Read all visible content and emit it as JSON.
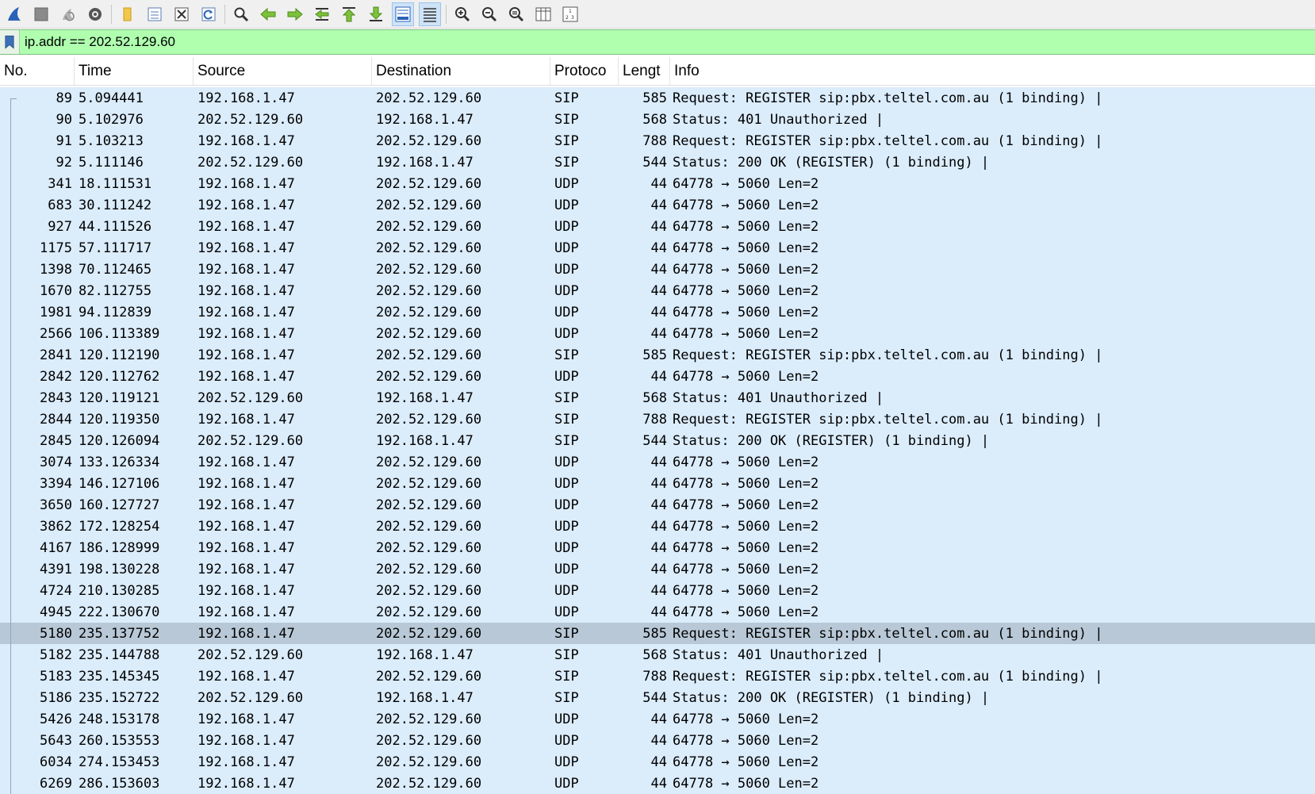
{
  "toolbar": {
    "buttons": [
      {
        "name": "shark-fin-start-icon"
      },
      {
        "name": "stop-capture-icon"
      },
      {
        "name": "restart-capture-icon"
      },
      {
        "name": "capture-options-icon"
      },
      {
        "name": "open-file-icon"
      },
      {
        "name": "save-file-icon"
      },
      {
        "name": "close-file-icon"
      },
      {
        "name": "reload-file-icon"
      },
      {
        "name": "find-packet-icon"
      },
      {
        "name": "go-back-icon"
      },
      {
        "name": "go-forward-icon"
      },
      {
        "name": "go-to-packet-icon"
      },
      {
        "name": "first-packet-icon"
      },
      {
        "name": "last-packet-icon"
      },
      {
        "name": "auto-scroll-icon"
      },
      {
        "name": "colorize-icon"
      },
      {
        "name": "zoom-in-icon"
      },
      {
        "name": "zoom-out-icon"
      },
      {
        "name": "normal-size-icon"
      },
      {
        "name": "resize-columns-icon"
      },
      {
        "name": "numbered-list-icon"
      }
    ]
  },
  "filter": {
    "value": "ip.addr == 202.52.129.60"
  },
  "columns": {
    "no": "No.",
    "time": "Time",
    "source": "Source",
    "destination": "Destination",
    "protocol": "Protoco",
    "length": "Lengt",
    "info": "Info"
  },
  "packets": [
    {
      "no": "89",
      "time": "5.094441",
      "src": "192.168.1.47",
      "dst": "202.52.129.60",
      "proto": "SIP",
      "len": "585",
      "info": "Request: REGISTER sip:pbx.teltel.com.au  (1 binding) |"
    },
    {
      "no": "90",
      "time": "5.102976",
      "src": "202.52.129.60",
      "dst": "192.168.1.47",
      "proto": "SIP",
      "len": "568",
      "info": "Status: 401 Unauthorized |"
    },
    {
      "no": "91",
      "time": "5.103213",
      "src": "192.168.1.47",
      "dst": "202.52.129.60",
      "proto": "SIP",
      "len": "788",
      "info": "Request: REGISTER sip:pbx.teltel.com.au  (1 binding) |"
    },
    {
      "no": "92",
      "time": "5.111146",
      "src": "202.52.129.60",
      "dst": "192.168.1.47",
      "proto": "SIP",
      "len": "544",
      "info": "Status: 200 OK (REGISTER)  (1 binding) |"
    },
    {
      "no": "341",
      "time": "18.111531",
      "src": "192.168.1.47",
      "dst": "202.52.129.60",
      "proto": "UDP",
      "len": "44",
      "info": "64778 → 5060 Len=2"
    },
    {
      "no": "683",
      "time": "30.111242",
      "src": "192.168.1.47",
      "dst": "202.52.129.60",
      "proto": "UDP",
      "len": "44",
      "info": "64778 → 5060 Len=2"
    },
    {
      "no": "927",
      "time": "44.111526",
      "src": "192.168.1.47",
      "dst": "202.52.129.60",
      "proto": "UDP",
      "len": "44",
      "info": "64778 → 5060 Len=2"
    },
    {
      "no": "1175",
      "time": "57.111717",
      "src": "192.168.1.47",
      "dst": "202.52.129.60",
      "proto": "UDP",
      "len": "44",
      "info": "64778 → 5060 Len=2"
    },
    {
      "no": "1398",
      "time": "70.112465",
      "src": "192.168.1.47",
      "dst": "202.52.129.60",
      "proto": "UDP",
      "len": "44",
      "info": "64778 → 5060 Len=2"
    },
    {
      "no": "1670",
      "time": "82.112755",
      "src": "192.168.1.47",
      "dst": "202.52.129.60",
      "proto": "UDP",
      "len": "44",
      "info": "64778 → 5060 Len=2"
    },
    {
      "no": "1981",
      "time": "94.112839",
      "src": "192.168.1.47",
      "dst": "202.52.129.60",
      "proto": "UDP",
      "len": "44",
      "info": "64778 → 5060 Len=2"
    },
    {
      "no": "2566",
      "time": "106.113389",
      "src": "192.168.1.47",
      "dst": "202.52.129.60",
      "proto": "UDP",
      "len": "44",
      "info": "64778 → 5060 Len=2"
    },
    {
      "no": "2841",
      "time": "120.112190",
      "src": "192.168.1.47",
      "dst": "202.52.129.60",
      "proto": "SIP",
      "len": "585",
      "info": "Request: REGISTER sip:pbx.teltel.com.au  (1 binding) |"
    },
    {
      "no": "2842",
      "time": "120.112762",
      "src": "192.168.1.47",
      "dst": "202.52.129.60",
      "proto": "UDP",
      "len": "44",
      "info": "64778 → 5060 Len=2"
    },
    {
      "no": "2843",
      "time": "120.119121",
      "src": "202.52.129.60",
      "dst": "192.168.1.47",
      "proto": "SIP",
      "len": "568",
      "info": "Status: 401 Unauthorized |"
    },
    {
      "no": "2844",
      "time": "120.119350",
      "src": "192.168.1.47",
      "dst": "202.52.129.60",
      "proto": "SIP",
      "len": "788",
      "info": "Request: REGISTER sip:pbx.teltel.com.au  (1 binding) |"
    },
    {
      "no": "2845",
      "time": "120.126094",
      "src": "202.52.129.60",
      "dst": "192.168.1.47",
      "proto": "SIP",
      "len": "544",
      "info": "Status: 200 OK (REGISTER)  (1 binding) |"
    },
    {
      "no": "3074",
      "time": "133.126334",
      "src": "192.168.1.47",
      "dst": "202.52.129.60",
      "proto": "UDP",
      "len": "44",
      "info": "64778 → 5060 Len=2"
    },
    {
      "no": "3394",
      "time": "146.127106",
      "src": "192.168.1.47",
      "dst": "202.52.129.60",
      "proto": "UDP",
      "len": "44",
      "info": "64778 → 5060 Len=2"
    },
    {
      "no": "3650",
      "time": "160.127727",
      "src": "192.168.1.47",
      "dst": "202.52.129.60",
      "proto": "UDP",
      "len": "44",
      "info": "64778 → 5060 Len=2"
    },
    {
      "no": "3862",
      "time": "172.128254",
      "src": "192.168.1.47",
      "dst": "202.52.129.60",
      "proto": "UDP",
      "len": "44",
      "info": "64778 → 5060 Len=2"
    },
    {
      "no": "4167",
      "time": "186.128999",
      "src": "192.168.1.47",
      "dst": "202.52.129.60",
      "proto": "UDP",
      "len": "44",
      "info": "64778 → 5060 Len=2"
    },
    {
      "no": "4391",
      "time": "198.130228",
      "src": "192.168.1.47",
      "dst": "202.52.129.60",
      "proto": "UDP",
      "len": "44",
      "info": "64778 → 5060 Len=2"
    },
    {
      "no": "4724",
      "time": "210.130285",
      "src": "192.168.1.47",
      "dst": "202.52.129.60",
      "proto": "UDP",
      "len": "44",
      "info": "64778 → 5060 Len=2"
    },
    {
      "no": "4945",
      "time": "222.130670",
      "src": "192.168.1.47",
      "dst": "202.52.129.60",
      "proto": "UDP",
      "len": "44",
      "info": "64778 → 5060 Len=2"
    },
    {
      "no": "5180",
      "time": "235.137752",
      "src": "192.168.1.47",
      "dst": "202.52.129.60",
      "proto": "SIP",
      "len": "585",
      "info": "Request: REGISTER sip:pbx.teltel.com.au  (1 binding) |",
      "selected": true
    },
    {
      "no": "5182",
      "time": "235.144788",
      "src": "202.52.129.60",
      "dst": "192.168.1.47",
      "proto": "SIP",
      "len": "568",
      "info": "Status: 401 Unauthorized |"
    },
    {
      "no": "5183",
      "time": "235.145345",
      "src": "192.168.1.47",
      "dst": "202.52.129.60",
      "proto": "SIP",
      "len": "788",
      "info": "Request: REGISTER sip:pbx.teltel.com.au  (1 binding) |"
    },
    {
      "no": "5186",
      "time": "235.152722",
      "src": "202.52.129.60",
      "dst": "192.168.1.47",
      "proto": "SIP",
      "len": "544",
      "info": "Status: 200 OK (REGISTER)  (1 binding) |"
    },
    {
      "no": "5426",
      "time": "248.153178",
      "src": "192.168.1.47",
      "dst": "202.52.129.60",
      "proto": "UDP",
      "len": "44",
      "info": "64778 → 5060 Len=2"
    },
    {
      "no": "5643",
      "time": "260.153553",
      "src": "192.168.1.47",
      "dst": "202.52.129.60",
      "proto": "UDP",
      "len": "44",
      "info": "64778 → 5060 Len=2"
    },
    {
      "no": "6034",
      "time": "274.153453",
      "src": "192.168.1.47",
      "dst": "202.52.129.60",
      "proto": "UDP",
      "len": "44",
      "info": "64778 → 5060 Len=2"
    },
    {
      "no": "6269",
      "time": "286.153603",
      "src": "192.168.1.47",
      "dst": "202.52.129.60",
      "proto": "UDP",
      "len": "44",
      "info": "64778 → 5060 Len=2"
    }
  ]
}
